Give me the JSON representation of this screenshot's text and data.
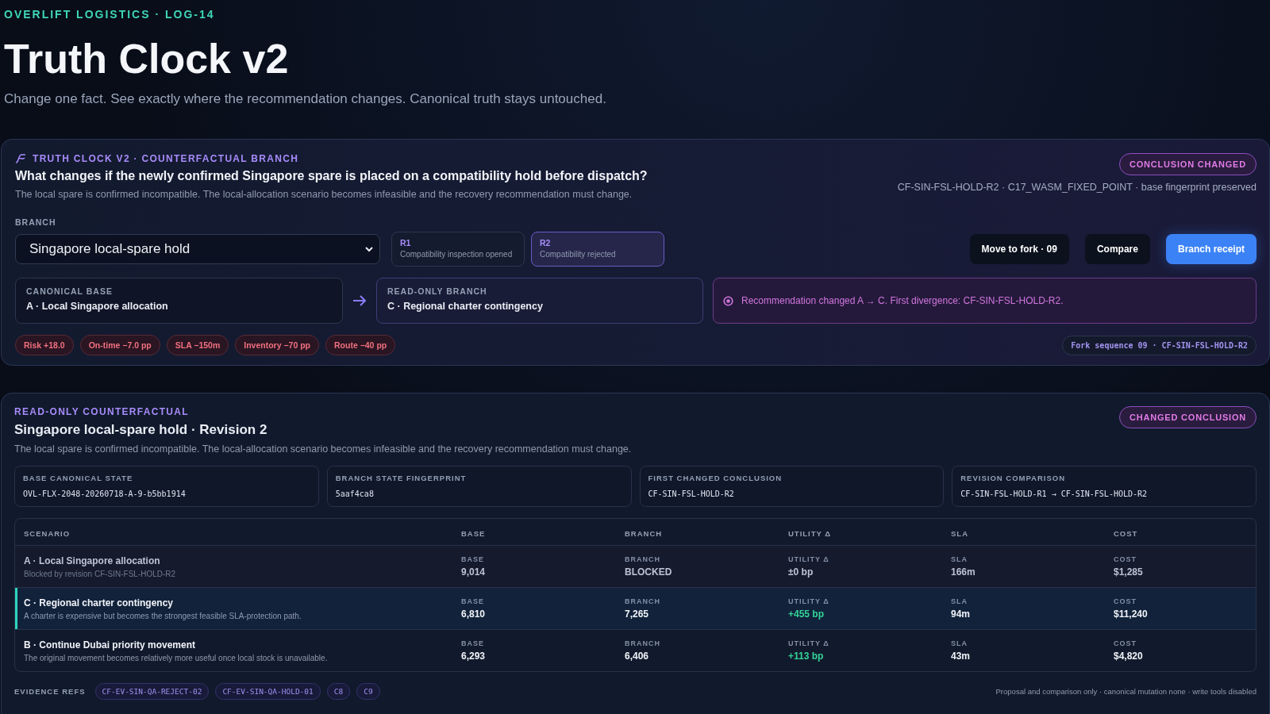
{
  "header": {
    "eyebrow": "OVERLIFT LOGISTICS · LOG-14",
    "title": "Truth Clock v2",
    "subtitle": "Change one fact. See exactly where the recommendation changes. Canonical truth stays untouched."
  },
  "branch_card": {
    "eyebrow": "TRUTH CLOCK V2 · COUNTERFACTUAL BRANCH",
    "question": "What changes if the newly confirmed Singapore spare is placed on a compatibility hold before dispatch?",
    "description": "The local spare is confirmed incompatible. The local-allocation scenario becomes infeasible and the recovery recommendation must change.",
    "badge": "CONCLUSION CHANGED",
    "meta": "CF-SIN-FSL-HOLD-R2 · C17_WASM_FIXED_POINT · base fingerprint preserved",
    "branch_label": "BRANCH",
    "branch_value": "Singapore local-spare hold",
    "revisions": [
      {
        "id": "R1",
        "label": "Compatibility inspection opened",
        "selected": false
      },
      {
        "id": "R2",
        "label": "Compatibility rejected",
        "selected": true
      }
    ],
    "buttons": [
      {
        "label": "Move to fork · 09",
        "kind": "dark"
      },
      {
        "label": "Compare",
        "kind": "dark"
      },
      {
        "label": "Branch receipt",
        "kind": "primary"
      }
    ],
    "base": {
      "label": "CANONICAL BASE",
      "value": "A · Local Singapore allocation"
    },
    "branch": {
      "label": "READ-ONLY BRANCH",
      "value": "C · Regional charter contingency"
    },
    "notice": "Recommendation changed A → C. First divergence: CF-SIN-FSL-HOLD-R2.",
    "deltas": [
      "Risk +18.0",
      "On-time −7.0 pp",
      "SLA −150m",
      "Inventory −70 pp",
      "Route −40 pp"
    ],
    "fork_sequence": "Fork sequence 09 · CF-SIN-FSL-HOLD-R2"
  },
  "result_card": {
    "eyebrow": "READ-ONLY COUNTERFACTUAL",
    "title": "Singapore local-spare hold · Revision 2",
    "description": "The local spare is confirmed incompatible. The local-allocation scenario becomes infeasible and the recovery recommendation must change.",
    "badge": "CHANGED CONCLUSION",
    "facts": [
      {
        "label": "BASE CANONICAL STATE",
        "value": "OVL-FLX-2048-20260718-A-9-b5bb1914"
      },
      {
        "label": "BRANCH STATE FINGERPRINT",
        "value": "5aaf4ca8"
      },
      {
        "label": "FIRST CHANGED CONCLUSION",
        "value": "CF-SIN-FSL-HOLD-R2"
      },
      {
        "label": "REVISION COMPARISON",
        "value": "CF-SIN-FSL-HOLD-R1 → CF-SIN-FSL-HOLD-R2"
      }
    ],
    "table": {
      "columns": [
        "SCENARIO",
        "BASE",
        "BRANCH",
        "UTILITY Δ",
        "SLA",
        "COST"
      ],
      "rows": [
        {
          "blocked": true,
          "selected": false,
          "cells": [
            {
              "kind": "scenario",
              "title": "A · Local Singapore allocation",
              "note": "Blocked by revision CF-SIN-FSL-HOLD-R2"
            },
            {
              "label": "BASE",
              "value": "9,014"
            },
            {
              "label": "BRANCH",
              "value": "BLOCKED"
            },
            {
              "label": "UTILITY Δ",
              "value": "±0 bp",
              "positive": false
            },
            {
              "label": "SLA",
              "value": "166m"
            },
            {
              "label": "COST",
              "value": "$1,285"
            }
          ]
        },
        {
          "blocked": false,
          "selected": true,
          "cells": [
            {
              "kind": "scenario",
              "title": "C · Regional charter contingency",
              "note": "A charter is expensive but becomes the strongest feasible SLA-protection path."
            },
            {
              "label": "BASE",
              "value": "6,810"
            },
            {
              "label": "BRANCH",
              "value": "7,265"
            },
            {
              "label": "UTILITY Δ",
              "value": "+455 bp",
              "positive": true
            },
            {
              "label": "SLA",
              "value": "94m"
            },
            {
              "label": "COST",
              "value": "$11,240"
            }
          ]
        },
        {
          "blocked": false,
          "selected": false,
          "cells": [
            {
              "kind": "scenario",
              "title": "B · Continue Dubai priority movement",
              "note": "The original movement becomes relatively more useful once local stock is unavailable."
            },
            {
              "label": "BASE",
              "value": "6,293"
            },
            {
              "label": "BRANCH",
              "value": "6,406"
            },
            {
              "label": "UTILITY Δ",
              "value": "+113 bp",
              "positive": true
            },
            {
              "label": "SLA",
              "value": "43m"
            },
            {
              "label": "COST",
              "value": "$4,820"
            }
          ]
        }
      ]
    },
    "evidence_label": "EVIDENCE REFS",
    "evidence": [
      "CF-EV-SIN-QA-REJECT-02",
      "CF-EV-SIN-QA-HOLD-01",
      "C8",
      "C9"
    ],
    "footnote": "Proposal and comparison only · canonical mutation none · write tools disabled"
  }
}
